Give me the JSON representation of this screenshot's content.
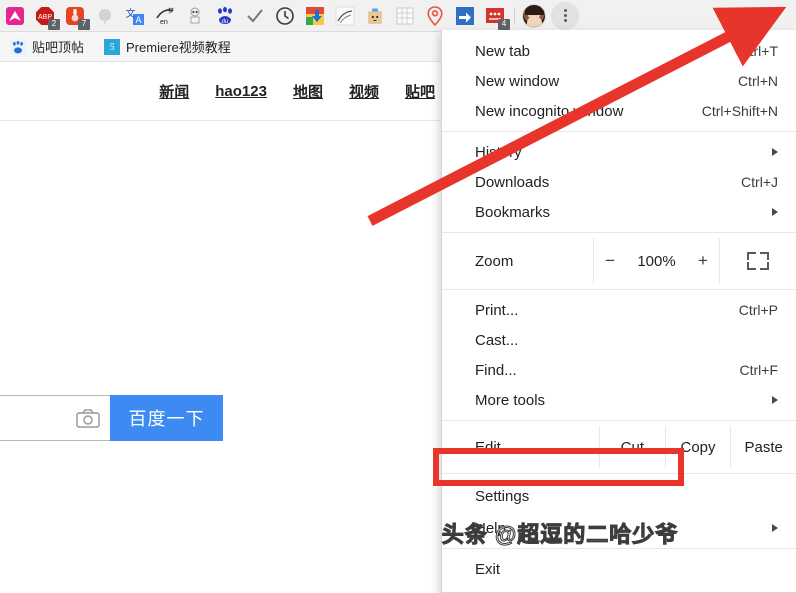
{
  "browser": {
    "toolbar": {
      "extensions": [
        {
          "name": "chevron-up-extension-icon",
          "badge": ""
        },
        {
          "name": "adblock-plus-icon",
          "badge": "2"
        },
        {
          "name": "red-square-extension-icon",
          "badge": "7"
        },
        {
          "name": "gray-circle-extension-icon",
          "badge": ""
        },
        {
          "name": "translate-icon",
          "badge": ""
        },
        {
          "name": "en-script-icon",
          "badge": ""
        },
        {
          "name": "robot-extension-icon",
          "badge": ""
        },
        {
          "name": "baidu-paw-icon",
          "badge": ""
        },
        {
          "name": "checkmark-icon",
          "badge": ""
        },
        {
          "name": "clock-icon",
          "badge": ""
        },
        {
          "name": "download-chrome-icon",
          "badge": ""
        },
        {
          "name": "sketch-extension-icon",
          "badge": ""
        },
        {
          "name": "box-face-extension-icon",
          "badge": ""
        },
        {
          "name": "grid-extension-icon",
          "badge": ""
        },
        {
          "name": "location-pin-icon",
          "badge": ""
        },
        {
          "name": "blue-arrow-icon",
          "badge": ""
        },
        {
          "name": "red-text-extension-icon",
          "badge": "4"
        }
      ],
      "avatar_label": "",
      "menu_button_label": ""
    },
    "bookmarks": [
      {
        "label": "贴吧顶帖",
        "favicon": "baidu-paw-favicon"
      },
      {
        "label": "Premiere视频教程",
        "favicon": "premiere-favicon"
      }
    ]
  },
  "page": {
    "nav_links": [
      "新闻",
      "hao123",
      "地图",
      "视频",
      "贴吧"
    ],
    "search": {
      "value": "",
      "placeholder": "",
      "camera_icon": "camera-icon",
      "button_label": "百度一下",
      "button_color": "#3d8bf2"
    }
  },
  "menu": {
    "groups": [
      {
        "items": [
          {
            "label": "New tab",
            "accel": "Ctrl+T",
            "submenu": false
          },
          {
            "label": "New window",
            "accel": "Ctrl+N",
            "submenu": false
          },
          {
            "label": "New incognito window",
            "accel": "Ctrl+Shift+N",
            "submenu": false
          }
        ]
      },
      {
        "items": [
          {
            "label": "History",
            "accel": "",
            "submenu": true
          },
          {
            "label": "Downloads",
            "accel": "Ctrl+J",
            "submenu": false
          },
          {
            "label": "Bookmarks",
            "accel": "",
            "submenu": true
          }
        ]
      }
    ],
    "zoom": {
      "label": "Zoom",
      "minus": "−",
      "value": "100%",
      "plus": "+",
      "fullscreen_icon": "fullscreen-icon"
    },
    "tools": [
      {
        "label": "Print...",
        "accel": "Ctrl+P",
        "submenu": false
      },
      {
        "label": "Cast...",
        "accel": "",
        "submenu": false
      },
      {
        "label": "Find...",
        "accel": "Ctrl+F",
        "submenu": false
      },
      {
        "label": "More tools",
        "accel": "",
        "submenu": true
      }
    ],
    "edit_row": {
      "label": "Edit",
      "actions": [
        "Cut",
        "Copy",
        "Paste"
      ]
    },
    "footer": [
      {
        "label": "Settings",
        "accel": "",
        "submenu": false,
        "highlighted": true
      },
      {
        "label": "Help",
        "accel": "",
        "submenu": true,
        "highlighted": false
      }
    ],
    "exit": {
      "label": "Exit",
      "accel": "",
      "submenu": false
    }
  },
  "annotations": {
    "highlight_color": "#e8352b",
    "arrow_color": "#e8352b",
    "watermark": "头条 @超逗的二哈少爷"
  }
}
